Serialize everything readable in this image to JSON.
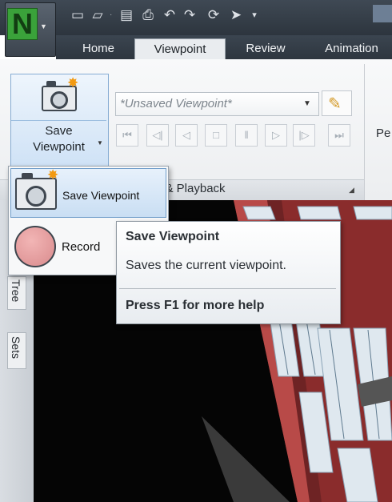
{
  "title_bar": {
    "app_icon": "navisworks-n-logo-icon",
    "quick_access": [
      "new-file-icon",
      "open-folder-icon",
      "save-icon",
      "print-icon",
      "undo-icon",
      "redo-icon",
      "refresh-icon",
      "select-arrow-icon"
    ]
  },
  "tabs": [
    {
      "label": "Home",
      "active": false
    },
    {
      "label": "Viewpoint",
      "active": true
    },
    {
      "label": "Review",
      "active": false
    },
    {
      "label": "Animation",
      "active": false
    }
  ],
  "ribbon": {
    "save_viewpoint_label_line1": "Save",
    "save_viewpoint_label_line2": "Viewpoint",
    "viewpoint_combo_value": "*Unsaved Viewpoint*",
    "playback_buttons": [
      "first-frame-icon",
      "step-back-icon",
      "play-reverse-icon",
      "stop-icon",
      "pause-icon",
      "play-icon",
      "step-forward-icon",
      "last-frame-icon"
    ],
    "panel_title": "d & Playback",
    "truncated_next_label": "Pe"
  },
  "dropdown": {
    "items": [
      {
        "label": "Save Viewpoint",
        "icon": "camera-star-icon",
        "highlighted": true
      },
      {
        "label": "Record",
        "icon": "record-circle-icon",
        "highlighted": false
      }
    ]
  },
  "tooltip": {
    "title": "Save Viewpoint",
    "description": "Saves the current viewpoint.",
    "help": "Press F1 for more help"
  },
  "side_tabs": [
    "Tree",
    "Sets"
  ],
  "colors": {
    "accent_blue": "#cfe2f6",
    "dark_titlebar": "#2d353e",
    "building_brick": "#8d2e2e"
  }
}
